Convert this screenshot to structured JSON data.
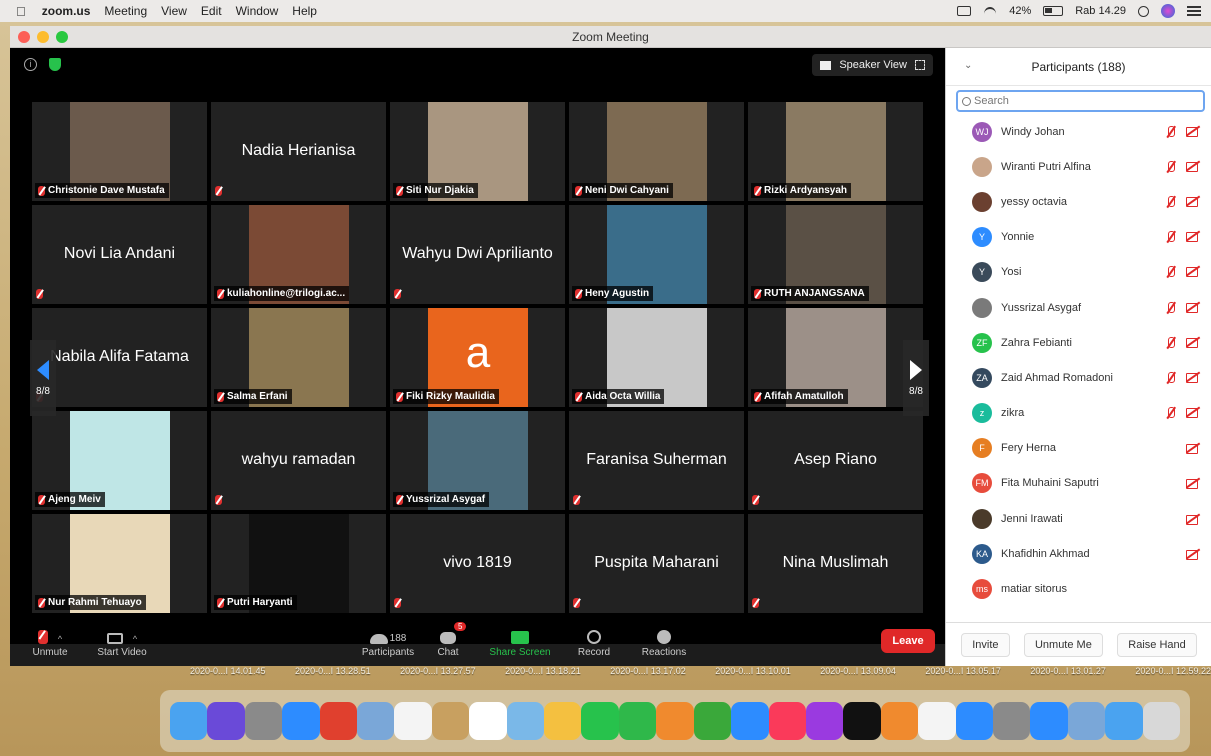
{
  "menubar": {
    "app": "zoom.us",
    "items": [
      "Meeting",
      "View",
      "Edit",
      "Window",
      "Help"
    ],
    "battery": "42%",
    "clock": "Rab 14.29"
  },
  "window": {
    "title": "Zoom Meeting"
  },
  "gallery": {
    "speaker_view_label": "Speaker View",
    "page_left": "8/8",
    "page_right": "8/8",
    "tiles": [
      {
        "type": "photo",
        "caption": "Christonie Dave Mustafa",
        "color": "#6b5a4c"
      },
      {
        "type": "name",
        "name": "Nadia Herianisa"
      },
      {
        "type": "photo",
        "caption": "Siti Nur Djakia",
        "color": "#a99680"
      },
      {
        "type": "photo",
        "caption": "Neni Dwi Cahyani",
        "color": "#7d6a52"
      },
      {
        "type": "photo",
        "caption": "Rizki Ardyansyah",
        "color": "#8a7a62"
      },
      {
        "type": "name",
        "name": "Novi Lia Andani"
      },
      {
        "type": "photo",
        "caption": "kuliahonline@trilogi.ac...",
        "color": "#7b4a35"
      },
      {
        "type": "name",
        "name": "Wahyu Dwi Aprilianto"
      },
      {
        "type": "photo",
        "caption": "Heny Agustin",
        "color": "#3a6d8a"
      },
      {
        "type": "photo",
        "caption": "RUTH ANJANGSANA",
        "color": "#5a5045"
      },
      {
        "type": "name",
        "name": "Nabila Alifa Fatama"
      },
      {
        "type": "photo",
        "caption": "Salma Erfani",
        "color": "#8a7650"
      },
      {
        "type": "letter",
        "letter": "a",
        "caption": "Fiki Rizky Maulidia",
        "color": "#e9651d"
      },
      {
        "type": "photo",
        "caption": "Aida Octa Willia",
        "color": "#c8c8c8"
      },
      {
        "type": "photo",
        "caption": "Afifah Amatulloh",
        "color": "#9c9088"
      },
      {
        "type": "photo",
        "caption": "Ajeng Meiv",
        "color": "#bfe6e6"
      },
      {
        "type": "name",
        "name": "wahyu ramadan"
      },
      {
        "type": "photo",
        "caption": "Yussrizal Asygaf",
        "color": "#4a6a7a"
      },
      {
        "type": "name",
        "name": "Faranisa Suherman"
      },
      {
        "type": "name",
        "name": "Asep Riano"
      },
      {
        "type": "photo",
        "caption": "Nur Rahmi Tehuayo",
        "color": "#e8d8b8"
      },
      {
        "type": "photo",
        "caption": "Putri Haryanti",
        "color": "#111111"
      },
      {
        "type": "name",
        "name": "vivo 1819"
      },
      {
        "type": "name",
        "name": "Puspita Maharani"
      },
      {
        "type": "name",
        "name": "Nina Muslimah"
      }
    ]
  },
  "toolbar": {
    "unmute": "Unmute",
    "start_video": "Start Video",
    "participants": "Participants",
    "participants_count": "188",
    "chat": "Chat",
    "chat_badge": "5",
    "share_screen": "Share Screen",
    "record": "Record",
    "reactions": "Reactions",
    "leave": "Leave"
  },
  "panel": {
    "title": "Participants (188)",
    "search_placeholder": "Search",
    "participants": [
      {
        "name": "Windy Johan",
        "initials": "WJ",
        "color": "#9b59b6",
        "mic": true,
        "cam": true
      },
      {
        "name": "Wiranti Putri Alfina",
        "initials": "",
        "color": "#c9a58a",
        "mic": true,
        "cam": true
      },
      {
        "name": "yessy octavia",
        "initials": "",
        "color": "#6b4030",
        "mic": true,
        "cam": true
      },
      {
        "name": "Yonnie",
        "initials": "Y",
        "color": "#2d8cff",
        "mic": true,
        "cam": true
      },
      {
        "name": "Yosi",
        "initials": "Y",
        "color": "#3a4a5a",
        "mic": true,
        "cam": true
      },
      {
        "name": "Yussrizal Asygaf",
        "initials": "",
        "color": "#7a7a7a",
        "mic": true,
        "cam": true
      },
      {
        "name": "Zahra Febianti",
        "initials": "ZF",
        "color": "#27c24c",
        "mic": true,
        "cam": true
      },
      {
        "name": "Zaid Ahmad Romadoni",
        "initials": "ZA",
        "color": "#34495e",
        "mic": true,
        "cam": true
      },
      {
        "name": "zikra",
        "initials": "z",
        "color": "#1abc9c",
        "mic": true,
        "cam": true
      },
      {
        "name": "Fery Herna",
        "initials": "F",
        "color": "#e67e22",
        "mic": false,
        "cam": true
      },
      {
        "name": "Fita Muhaini Saputri",
        "initials": "FM",
        "color": "#e74c3c",
        "mic": false,
        "cam": true
      },
      {
        "name": "Jenni Irawati",
        "initials": "",
        "color": "#4a3a2a",
        "mic": false,
        "cam": true
      },
      {
        "name": "Khafidhin Akhmad",
        "initials": "KA",
        "color": "#2c5a8c",
        "mic": false,
        "cam": true
      },
      {
        "name": "matiar sitorus",
        "initials": "ms",
        "color": "#e74c3c",
        "mic": false,
        "cam": false
      }
    ],
    "invite": "Invite",
    "unmute_me": "Unmute Me",
    "raise_hand": "Raise Hand"
  },
  "desktop_files": [
    "2020-0...I 14.01.45",
    "2020-0...I 13.28.51",
    "2020-0...I 13.27.57",
    "2020-0...I 13.18.21",
    "2020-0...I 13.17.02",
    "2020-0...I 13.10.01",
    "2020-0...I 13.09.04",
    "2020-0...I 13.05.17",
    "2020-0...I 13.01.27",
    "2020-0...I 12.59.22"
  ],
  "dock_icons": [
    {
      "name": "finder",
      "color": "#4aa3f0"
    },
    {
      "name": "siri",
      "color": "#6a4ad8"
    },
    {
      "name": "launchpad",
      "color": "#8a8a8a"
    },
    {
      "name": "safari",
      "color": "#2d8cff"
    },
    {
      "name": "chrome",
      "color": "#e0402e"
    },
    {
      "name": "preview",
      "color": "#7aa7d8"
    },
    {
      "name": "notes-list",
      "color": "#f4f4f4"
    },
    {
      "name": "notebook",
      "color": "#c8a060"
    },
    {
      "name": "calendar",
      "color": "#ffffff"
    },
    {
      "name": "photos-folder",
      "color": "#7ab8e8"
    },
    {
      "name": "photos",
      "color": "#f4c040"
    },
    {
      "name": "messages",
      "color": "#27c24c"
    },
    {
      "name": "facetime",
      "color": "#2fb84a"
    },
    {
      "name": "pages",
      "color": "#f08a2e"
    },
    {
      "name": "numbers",
      "color": "#3aa83a"
    },
    {
      "name": "keynote",
      "color": "#2d8cff"
    },
    {
      "name": "music",
      "color": "#fa3a5a"
    },
    {
      "name": "podcasts",
      "color": "#9a3ae0"
    },
    {
      "name": "apple-tv",
      "color": "#111111"
    },
    {
      "name": "books",
      "color": "#f08a2e"
    },
    {
      "name": "blank",
      "color": "#f4f4f4"
    },
    {
      "name": "app-store",
      "color": "#2d8cff"
    },
    {
      "name": "system-preferences",
      "color": "#8a8a8a"
    },
    {
      "name": "zoom",
      "color": "#2d8cff"
    },
    {
      "name": "image-capture",
      "color": "#7aa7d8"
    },
    {
      "name": "screen-share",
      "color": "#4aa3f0"
    },
    {
      "name": "trash",
      "color": "#d8d8d8"
    }
  ]
}
